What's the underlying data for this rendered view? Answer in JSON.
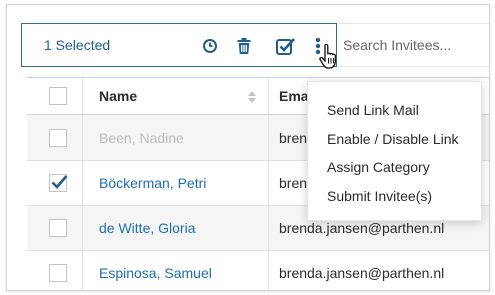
{
  "toolbar": {
    "selected_label": "1 Selected",
    "icons": [
      "history-icon",
      "trash-icon",
      "check-square-icon",
      "kebab-menu-icon"
    ]
  },
  "search": {
    "placeholder": "Search Invitees..."
  },
  "table": {
    "columns": [
      "Name",
      "Ema"
    ],
    "rows": [
      {
        "name": "Been, Nadine",
        "email": "bren",
        "checked": false,
        "disabled": true
      },
      {
        "name": "Böckerman, Petri",
        "email": "bren",
        "checked": true,
        "disabled": false
      },
      {
        "name": "de Witte, Gloria",
        "email": "brenda.jansen@parthen.nl",
        "checked": false,
        "disabled": false
      },
      {
        "name": "Espinosa, Samuel",
        "email": "brenda.jansen@parthen.nl",
        "checked": false,
        "disabled": false
      }
    ]
  },
  "menu": {
    "items": [
      "Send Link Mail",
      "Enable / Disable Link",
      "Assign Category",
      "Submit Invitee(s)"
    ]
  },
  "colors": {
    "accent": "#1e5d8e",
    "link": "#1e6fb0",
    "border": "#cfd3d6"
  }
}
